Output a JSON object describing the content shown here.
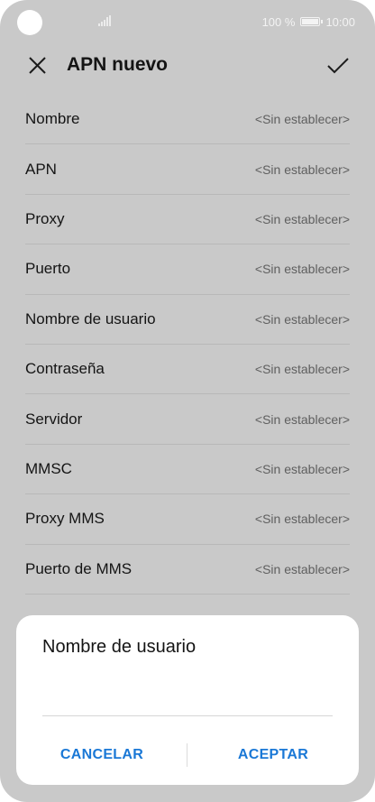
{
  "status_bar": {
    "battery_percent": "100 %",
    "time": "10:00"
  },
  "header": {
    "title": "APN nuevo"
  },
  "settings": {
    "items": [
      {
        "label": "Nombre",
        "value": "<Sin establecer>"
      },
      {
        "label": "APN",
        "value": "<Sin establecer>"
      },
      {
        "label": "Proxy",
        "value": "<Sin establecer>"
      },
      {
        "label": "Puerto",
        "value": "<Sin establecer>"
      },
      {
        "label": "Nombre de usuario",
        "value": "<Sin establecer>"
      },
      {
        "label": "Contraseña",
        "value": "<Sin establecer>"
      },
      {
        "label": "Servidor",
        "value": "<Sin establecer>"
      },
      {
        "label": "MMSC",
        "value": "<Sin establecer>"
      },
      {
        "label": "Proxy MMS",
        "value": "<Sin establecer>"
      },
      {
        "label": "Puerto de MMS",
        "value": "<Sin establecer>"
      }
    ]
  },
  "dialog": {
    "title": "Nombre de usuario",
    "input_value": "",
    "cancel_label": "CANCELAR",
    "accept_label": "ACEPTAR"
  },
  "colors": {
    "accent": "#1a78d6",
    "overlay": "#c9c9c9"
  }
}
